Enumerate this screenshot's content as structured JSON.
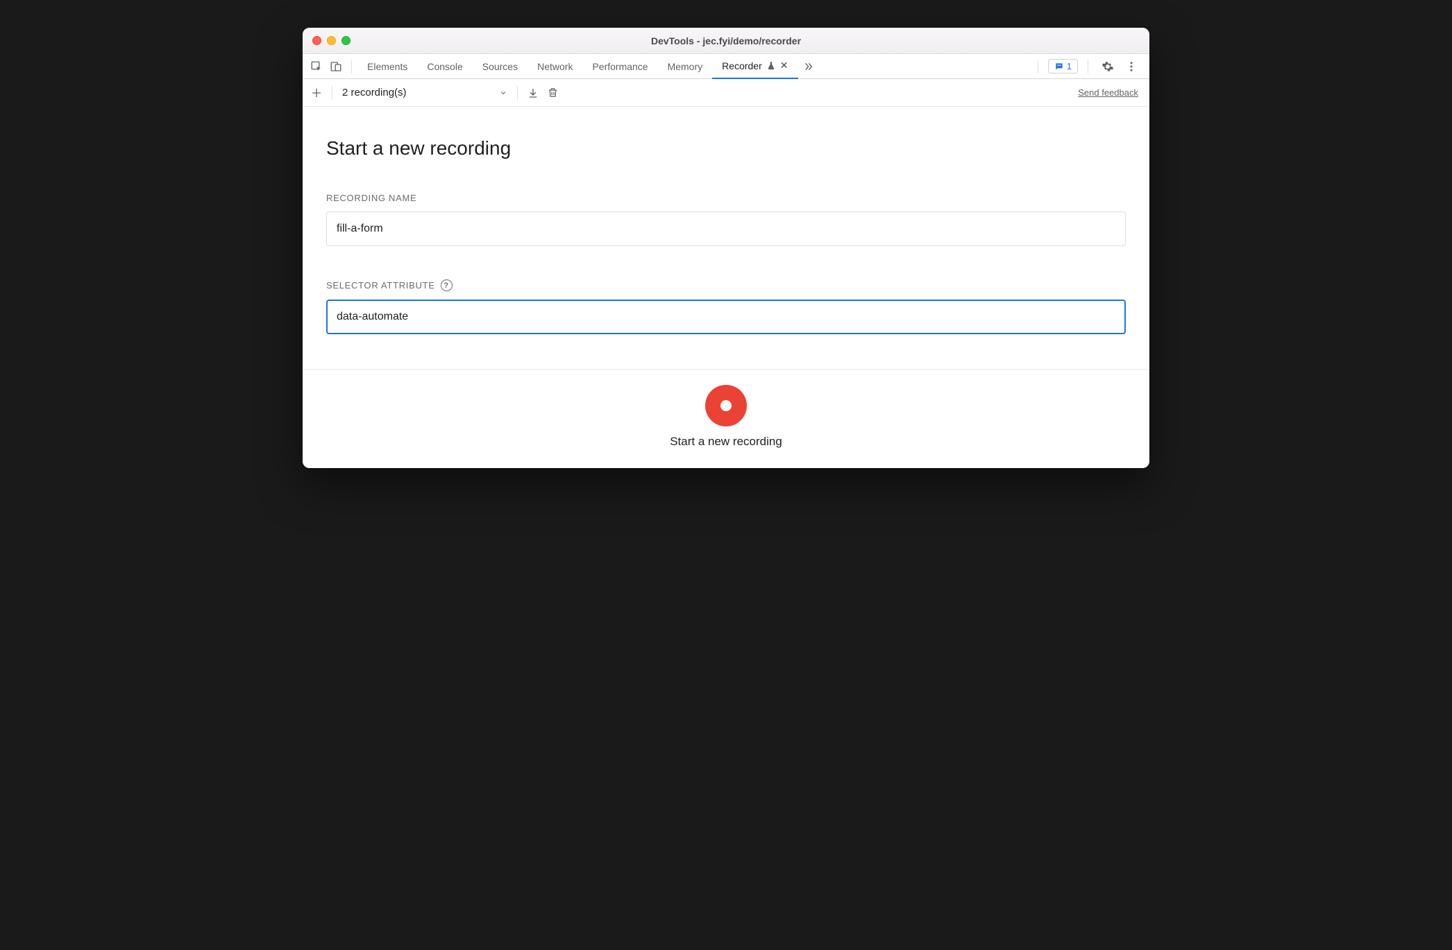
{
  "window": {
    "title": "DevTools - jec.fyi/demo/recorder"
  },
  "tabs": {
    "items": [
      {
        "label": "Elements"
      },
      {
        "label": "Console"
      },
      {
        "label": "Sources"
      },
      {
        "label": "Network"
      },
      {
        "label": "Performance"
      },
      {
        "label": "Memory"
      },
      {
        "label": "Recorder"
      }
    ],
    "active_index": 6,
    "issues_count": "1"
  },
  "toolbar": {
    "recordings_label": "2 recording(s)",
    "feedback_label": "Send feedback"
  },
  "main": {
    "title": "Start a new recording",
    "recording_name_label": "RECORDING NAME",
    "recording_name_value": "fill-a-form",
    "selector_attr_label": "SELECTOR ATTRIBUTE",
    "selector_attr_value": "data-automate"
  },
  "footer": {
    "record_label": "Start a new recording"
  },
  "colors": {
    "accent": "#1a73e8",
    "record": "#ea4335"
  }
}
